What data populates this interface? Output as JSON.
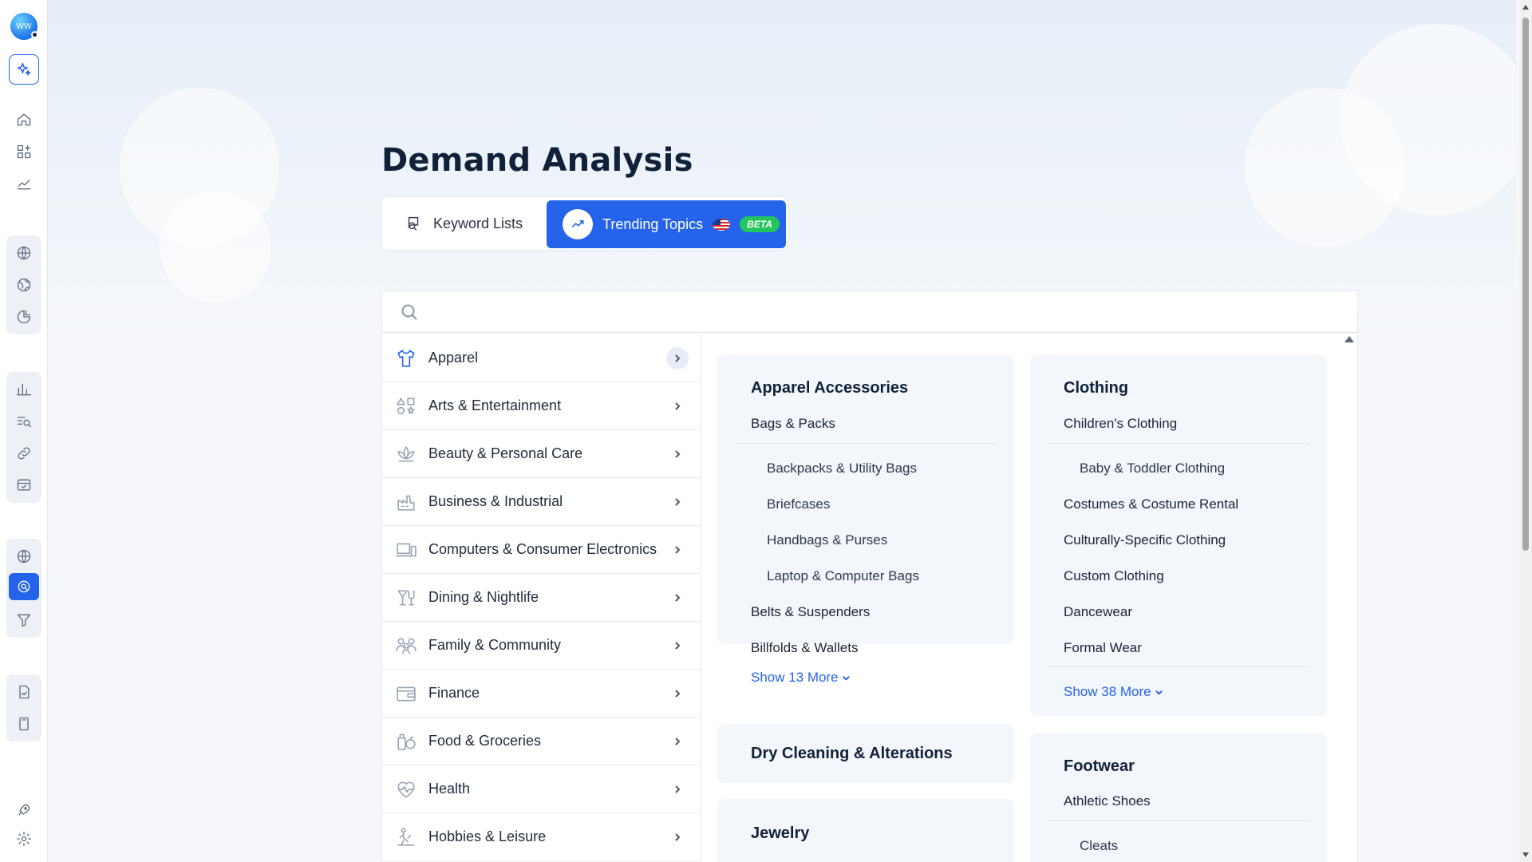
{
  "page": {
    "title": "Demand Analysis"
  },
  "tabs": {
    "keyword_lists": "Keyword Lists",
    "trending_topics": "Trending Topics",
    "beta_badge": "BETA"
  },
  "search": {
    "placeholder": ""
  },
  "categories": [
    {
      "label": "Apparel",
      "icon": "shirt-icon"
    },
    {
      "label": "Arts & Entertainment",
      "icon": "shapes-icon"
    },
    {
      "label": "Beauty & Personal Care",
      "icon": "lotus-icon"
    },
    {
      "label": "Business & Industrial",
      "icon": "factory-icon"
    },
    {
      "label": "Computers & Consumer Electronics",
      "icon": "devices-icon"
    },
    {
      "label": "Dining & Nightlife",
      "icon": "cocktail-icon"
    },
    {
      "label": "Family & Community",
      "icon": "family-icon"
    },
    {
      "label": "Finance",
      "icon": "wallet-icon"
    },
    {
      "label": "Food & Groceries",
      "icon": "groceries-icon"
    },
    {
      "label": "Health",
      "icon": "heart-pulse-icon"
    },
    {
      "label": "Hobbies & Leisure",
      "icon": "hobbies-icon"
    }
  ],
  "cards": {
    "apparel_accessories": {
      "title": "Apparel Accessories",
      "bags_packs": "Bags & Packs",
      "bags_subs": [
        "Backpacks & Utility Bags",
        "Briefcases",
        "Handbags & Purses",
        "Laptop & Computer Bags"
      ],
      "belts": "Belts & Suspenders",
      "billfolds": "Billfolds & Wallets",
      "show_more": "Show 13 More"
    },
    "clothing": {
      "title": "Clothing",
      "childrens": "Children's Clothing",
      "childrens_subs": [
        "Baby & Toddler Clothing"
      ],
      "items": [
        "Costumes & Costume Rental",
        "Culturally-Specific Clothing",
        "Custom Clothing",
        "Dancewear",
        "Formal Wear"
      ],
      "show_more": "Show 38 More"
    },
    "dry_cleaning": {
      "title": "Dry Cleaning & Alterations"
    },
    "jewelry": {
      "title": "Jewelry"
    },
    "footwear": {
      "title": "Footwear",
      "athletic": "Athletic Shoes",
      "athletic_subs": [
        "Cleats"
      ]
    }
  },
  "colors": {
    "accent": "#2563eb",
    "beta": "#22c55e",
    "card_bg": "#f3f6fa"
  },
  "logo_text": "WW"
}
